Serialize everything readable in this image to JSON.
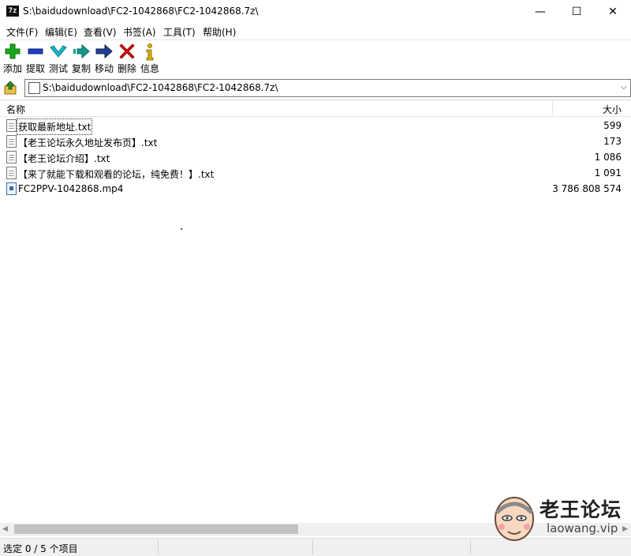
{
  "window": {
    "icon_text": "7z",
    "title": "S:\\baidudownload\\FC2-1042868\\FC2-1042868.7z\\",
    "minimize": "—",
    "maximize": "☐",
    "close": "✕"
  },
  "menu": [
    "文件(F)",
    "编辑(E)",
    "查看(V)",
    "书签(A)",
    "工具(T)",
    "帮助(H)"
  ],
  "toolbar": [
    {
      "label": "添加",
      "icon": "plus-icon",
      "color": "#1aa81a"
    },
    {
      "label": "提取",
      "icon": "minus-icon",
      "color": "#1a3fbf"
    },
    {
      "label": "测试",
      "icon": "check-icon",
      "color": "#19b5c8"
    },
    {
      "label": "复制",
      "icon": "copy-arrow-icon",
      "color": "#139b8f"
    },
    {
      "label": "移动",
      "icon": "move-arrow-icon",
      "color": "#1f3f8f"
    },
    {
      "label": "删除",
      "icon": "delete-x-icon",
      "color": "#d01010"
    },
    {
      "label": "信息",
      "icon": "info-icon",
      "color": "#d4b000"
    }
  ],
  "address": {
    "path": "S:\\baidudownload\\FC2-1042868\\FC2-1042868.7z\\",
    "dropdown": "⌵"
  },
  "list": {
    "columns": {
      "name": "名称",
      "size": "大小"
    },
    "rows": [
      {
        "name": "获取最新地址.txt",
        "size": "599",
        "type": "text"
      },
      {
        "name": "【老王论坛永久地址发布页】.txt",
        "size": "173",
        "type": "text"
      },
      {
        "name": "【老王论坛介绍】.txt",
        "size": "1 086",
        "type": "text"
      },
      {
        "name": "【来了就能下载和观看的论坛，纯免费！】.txt",
        "size": "1 091",
        "type": "text"
      },
      {
        "name": "FC2PPV-1042868.mp4",
        "size": "3 786 808 574",
        "type": "video"
      }
    ]
  },
  "scrollbar": {
    "left": "◀",
    "right": "▶"
  },
  "status": {
    "selection": "选定 0 / 5 个项目"
  },
  "watermark": {
    "title": "老王论坛",
    "url": "laowang.vip"
  }
}
